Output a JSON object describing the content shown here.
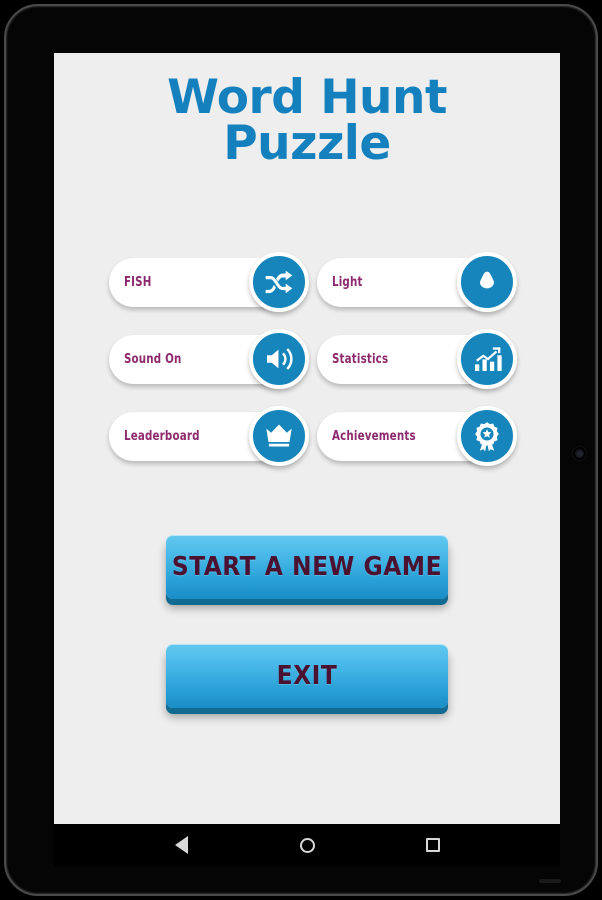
{
  "app": {
    "title_line1": "Word Hunt",
    "title_line2": "Puzzle",
    "accent_blue": "#1480bd",
    "icon_circle_blue": "#1585bc",
    "label_magenta": "#8d2a6d",
    "screen_background": "#eeeeee"
  },
  "options": [
    {
      "label": "FISH",
      "icon": "shuffle-icon"
    },
    {
      "label": "Light",
      "icon": "theme-shield-icon"
    },
    {
      "label": "Sound On",
      "icon": "speaker-volume-icon"
    },
    {
      "label": "Statistics",
      "icon": "bar-chart-icon"
    },
    {
      "label": "Leaderboard",
      "icon": "crown-icon"
    },
    {
      "label": "Achievements",
      "icon": "award-medal-icon"
    }
  ],
  "actions": {
    "start_label": "START A NEW GAME",
    "exit_label": "EXIT"
  },
  "navbar": {
    "back": "back-icon",
    "home": "home-icon",
    "recents": "recents-icon"
  }
}
